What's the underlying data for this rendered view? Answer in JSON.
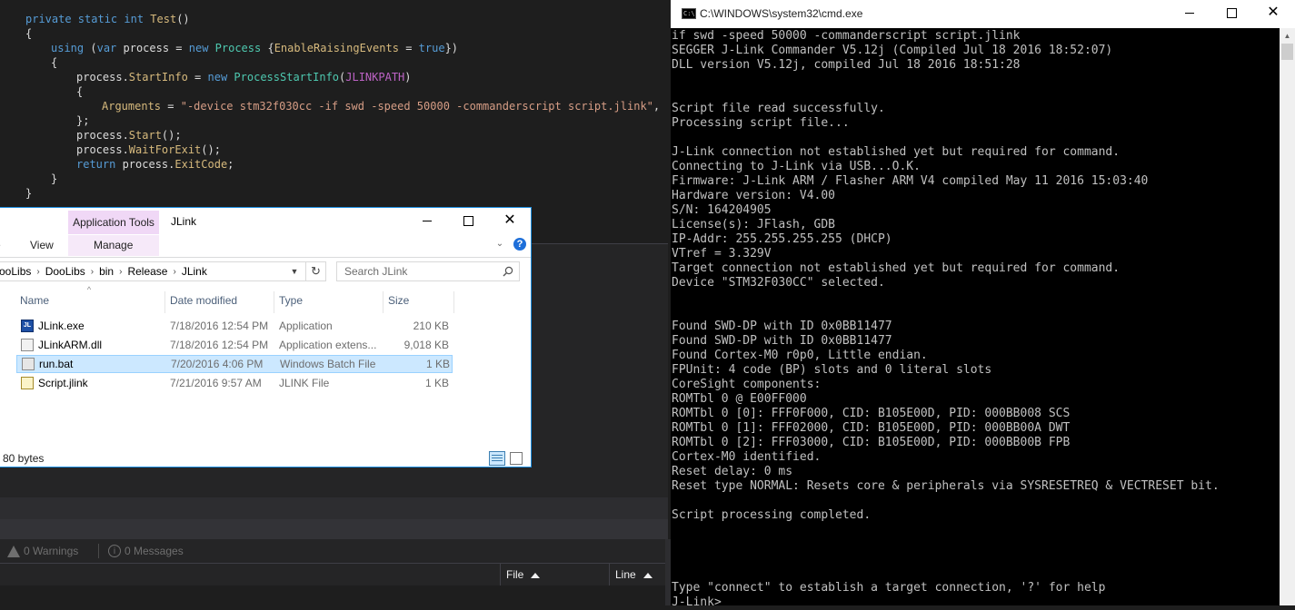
{
  "editor": {
    "lines": [
      {
        "indent": 28,
        "parts": [
          [
            "kw",
            "private "
          ],
          [
            "kw",
            "static "
          ],
          [
            "kw",
            "int "
          ],
          [
            "mb",
            "Test"
          ],
          [
            "pl",
            "()"
          ]
        ]
      },
      {
        "indent": 28,
        "parts": [
          [
            "pl",
            "{"
          ]
        ]
      },
      {
        "indent": 56,
        "parts": [
          [
            "kw",
            "using "
          ],
          [
            "pl",
            "("
          ],
          [
            "kw",
            "var "
          ],
          [
            "pl",
            "process = "
          ],
          [
            "kw",
            "new "
          ],
          [
            "tp",
            "Process "
          ],
          [
            "pl",
            "{"
          ],
          [
            "mb",
            "EnableRaisingEvents"
          ],
          [
            "pl",
            " = "
          ],
          [
            "kw",
            "true"
          ],
          [
            "pl",
            "})"
          ]
        ]
      },
      {
        "indent": 56,
        "parts": [
          [
            "pl",
            "{"
          ]
        ]
      },
      {
        "indent": 84,
        "parts": [
          [
            "pl",
            "process."
          ],
          [
            "mb",
            "StartInfo"
          ],
          [
            "pl",
            " = "
          ],
          [
            "kw",
            "new "
          ],
          [
            "tp",
            "ProcessStartInfo"
          ],
          [
            "pl",
            "("
          ],
          [
            "lb",
            "JLINKPATH"
          ],
          [
            "pl",
            ")"
          ]
        ]
      },
      {
        "indent": 84,
        "parts": [
          [
            "pl",
            "{"
          ]
        ]
      },
      {
        "indent": 112,
        "parts": [
          [
            "mb",
            "Arguments"
          ],
          [
            "pl",
            " = "
          ],
          [
            "st",
            "\"-device stm32f030cc -if swd -speed 50000 -commanderscript script.jlink\""
          ],
          [
            "pl",
            ","
          ]
        ]
      },
      {
        "indent": 84,
        "parts": [
          [
            "pl",
            "};"
          ]
        ]
      },
      {
        "indent": 84,
        "parts": [
          [
            "pl",
            "process."
          ],
          [
            "mb",
            "Start"
          ],
          [
            "pl",
            "();"
          ]
        ]
      },
      {
        "indent": 84,
        "parts": [
          [
            "pl",
            "process."
          ],
          [
            "mb",
            "WaitForExit"
          ],
          [
            "pl",
            "();"
          ]
        ]
      },
      {
        "indent": 84,
        "parts": [
          [
            "kw",
            "return "
          ],
          [
            "pl",
            "process."
          ],
          [
            "mb",
            "ExitCode"
          ],
          [
            "pl",
            ";"
          ]
        ]
      },
      {
        "indent": 56,
        "parts": [
          [
            "pl",
            "}"
          ]
        ]
      },
      {
        "indent": 28,
        "parts": [
          [
            "pl",
            "}"
          ]
        ]
      }
    ]
  },
  "error_list": {
    "warnings": "0 Warnings",
    "messages": "0 Messages",
    "col_file": "File",
    "col_line": "Line"
  },
  "explorer": {
    "context_tab": "Application Tools",
    "title": "JLink",
    "ribbon": {
      "share": "e",
      "view": "View",
      "manage": "Manage"
    },
    "address": [
      "ooLibs",
      "DooLibs",
      "bin",
      "Release",
      "JLink"
    ],
    "search_placeholder": "Search JLink",
    "columns": {
      "name": "Name",
      "date": "Date modified",
      "type": "Type",
      "size": "Size"
    },
    "files": [
      {
        "name": "JLink.exe",
        "date": "7/18/2016 12:54 PM",
        "type": "Application",
        "size": "210 KB",
        "icon": "exe-icon",
        "selected": false
      },
      {
        "name": "JLinkARM.dll",
        "date": "7/18/2016 12:54 PM",
        "type": "Application extens...",
        "size": "9,018 KB",
        "icon": "dll-icon",
        "selected": false
      },
      {
        "name": "run.bat",
        "date": "7/20/2016 4:06 PM",
        "type": "Windows Batch File",
        "size": "1 KB",
        "icon": "bat-icon",
        "selected": true
      },
      {
        "name": "Script.jlink",
        "date": "7/21/2016 9:57 AM",
        "type": "JLINK File",
        "size": "1 KB",
        "icon": "jlink-file-icon",
        "selected": false
      }
    ],
    "status": "80 bytes"
  },
  "cmd": {
    "title": "C:\\WINDOWS\\system32\\cmd.exe",
    "lines": [
      "if swd -speed 50000 -commanderscript script.jlink",
      "SEGGER J-Link Commander V5.12j (Compiled Jul 18 2016 18:52:07)",
      "DLL version V5.12j, compiled Jul 18 2016 18:51:28",
      "",
      "",
      "Script file read successfully.",
      "Processing script file...",
      "",
      "J-Link connection not established yet but required for command.",
      "Connecting to J-Link via USB...O.K.",
      "Firmware: J-Link ARM / Flasher ARM V4 compiled May 11 2016 15:03:40",
      "Hardware version: V4.00",
      "S/N: 164204905",
      "License(s): JFlash, GDB",
      "IP-Addr: 255.255.255.255 (DHCP)",
      "VTref = 3.329V",
      "Target connection not established yet but required for command.",
      "Device \"STM32F030CC\" selected.",
      "",
      "",
      "Found SWD-DP with ID 0x0BB11477",
      "Found SWD-DP with ID 0x0BB11477",
      "Found Cortex-M0 r0p0, Little endian.",
      "FPUnit: 4 code (BP) slots and 0 literal slots",
      "CoreSight components:",
      "ROMTbl 0 @ E00FF000",
      "ROMTbl 0 [0]: FFF0F000, CID: B105E00D, PID: 000BB008 SCS",
      "ROMTbl 0 [1]: FFF02000, CID: B105E00D, PID: 000BB00A DWT",
      "ROMTbl 0 [2]: FFF03000, CID: B105E00D, PID: 000BB00B FPB",
      "Cortex-M0 identified.",
      "Reset delay: 0 ms",
      "Reset type NORMAL: Resets core & peripherals via SYSRESETREQ & VECTRESET bit.",
      "",
      "Script processing completed.",
      "",
      "",
      "",
      "",
      "Type \"connect\" to establish a target connection, '?' for help",
      "J-Link>"
    ]
  }
}
